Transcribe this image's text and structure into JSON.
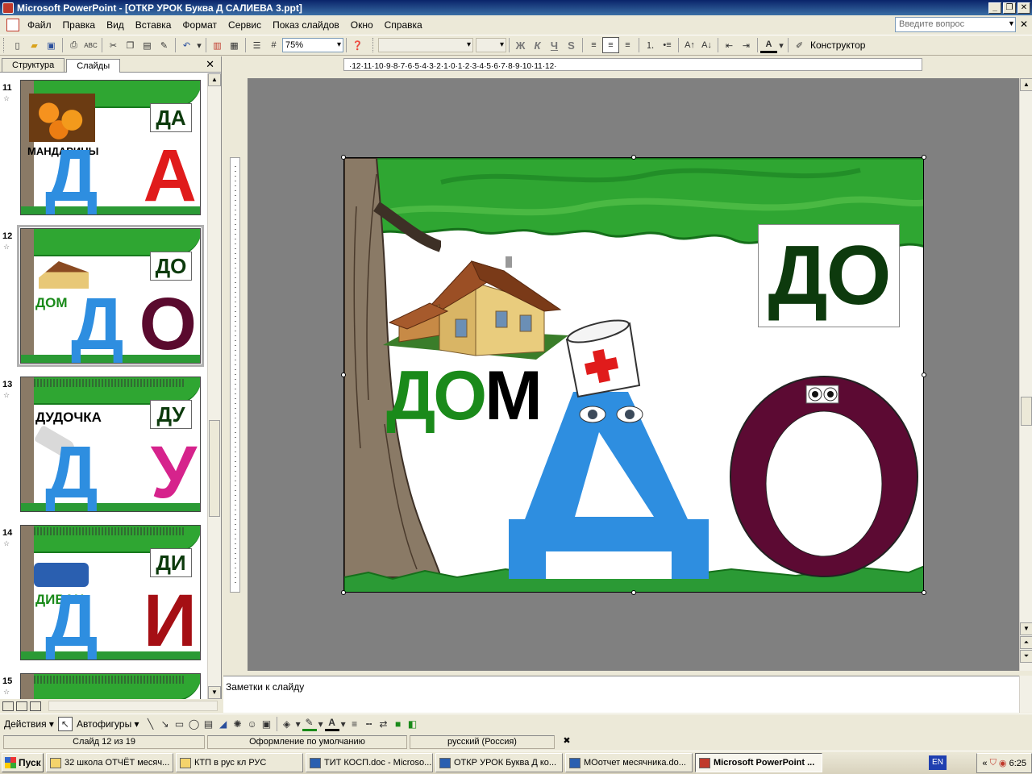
{
  "window": {
    "title": "Microsoft PowerPoint - [ОТКР УРОК Буква Д  САЛИЕВА 3.ppt]"
  },
  "menu": {
    "items": [
      "Файл",
      "Правка",
      "Вид",
      "Вставка",
      "Формат",
      "Сервис",
      "Показ слайдов",
      "Окно",
      "Справка"
    ],
    "ask_placeholder": "Введите вопрос"
  },
  "toolbar": {
    "zoom": "75%",
    "designer_label": "Конструктор"
  },
  "left_panel": {
    "tabs": [
      "Структура",
      "Слайды"
    ],
    "active_tab": "Слайды",
    "thumbnails": [
      {
        "number": "11",
        "syllable": "ДА",
        "letter": "А",
        "word": "МАНДАРИНЫ",
        "letter_color": "#e01b1b"
      },
      {
        "number": "12",
        "syllable": "ДО",
        "letter": "О",
        "word": "ДОМ",
        "letter_color": "#5a0a2e"
      },
      {
        "number": "13",
        "syllable": "ДУ",
        "letter": "У",
        "word": "ДУДОЧКА",
        "letter_color": "#d6238c"
      },
      {
        "number": "14",
        "syllable": "ДИ",
        "letter": "И",
        "word": "ДИВАН",
        "letter_color": "#a50f14"
      },
      {
        "number": "15",
        "syllable": "",
        "letter": "",
        "word": "",
        "letter_color": "#2e8ee0"
      }
    ]
  },
  "slide": {
    "syllable": "ДО",
    "word_green": "ДО",
    "word_black": "М",
    "letter_d_color": "#2e8ee0",
    "letter_o_color": "#5c0a33"
  },
  "notes": {
    "placeholder": "Заметки к слайду"
  },
  "drawing_toolbar": {
    "actions": "Действия",
    "autoshapes": "Автофигуры"
  },
  "status": {
    "slide_counter": "Слайд 12 из 19",
    "design": "Оформление по умолчанию",
    "language": "русский (Россия)"
  },
  "taskbar": {
    "start": "Пуск",
    "tasks": [
      {
        "label": "32 школа ОТЧЁТ месяч...",
        "active": false
      },
      {
        "label": "КТП в рус кл РУС",
        "active": false
      },
      {
        "label": "ТИТ КОСП.doc - Microso...",
        "active": false
      },
      {
        "label": "ОТКР УРОК Буква Д ко...",
        "active": false
      },
      {
        "label": "МОотчет месячника.do...",
        "active": false
      },
      {
        "label": "Microsoft PowerPoint ...",
        "active": true
      }
    ],
    "lang": "EN",
    "clock": "6:25"
  }
}
